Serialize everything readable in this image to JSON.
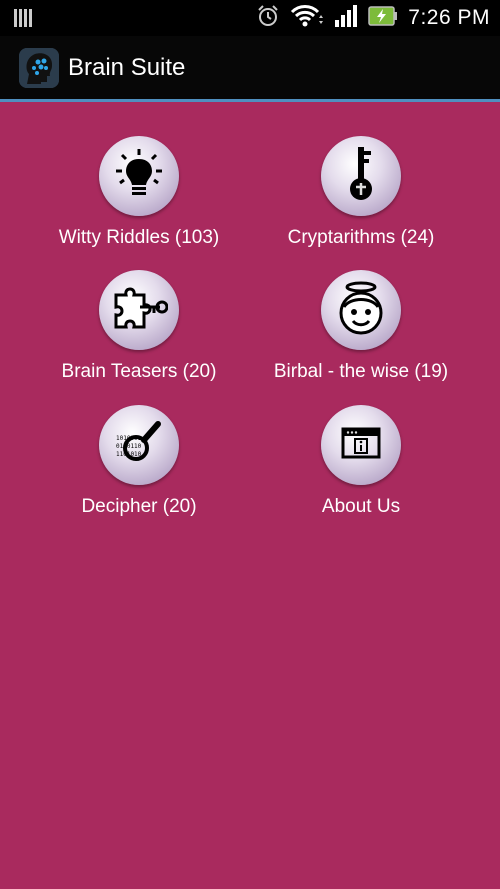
{
  "status_bar": {
    "time": "7:26 PM",
    "icons": [
      "notification-icon",
      "alarm-icon",
      "wifi-icon",
      "signal-icon",
      "battery-charging-icon"
    ]
  },
  "action_bar": {
    "title": "Brain Suite",
    "icon": "brain-head-icon"
  },
  "menu": {
    "items": [
      {
        "label": "Witty Riddles (103)",
        "icon": "lightbulb-icon"
      },
      {
        "label": "Cryptarithms (24)",
        "icon": "key-icon"
      },
      {
        "label": "Brain Teasers (20)",
        "icon": "puzzle-key-icon"
      },
      {
        "label": "Birbal - the wise (19)",
        "icon": "angel-face-icon"
      },
      {
        "label": "Decipher (20)",
        "icon": "magnifier-binary-icon"
      },
      {
        "label": "About Us",
        "icon": "info-window-icon"
      }
    ]
  },
  "colors": {
    "background": "#a92a5e",
    "divider": "#4f8fc0",
    "action_bar": "#070707"
  }
}
